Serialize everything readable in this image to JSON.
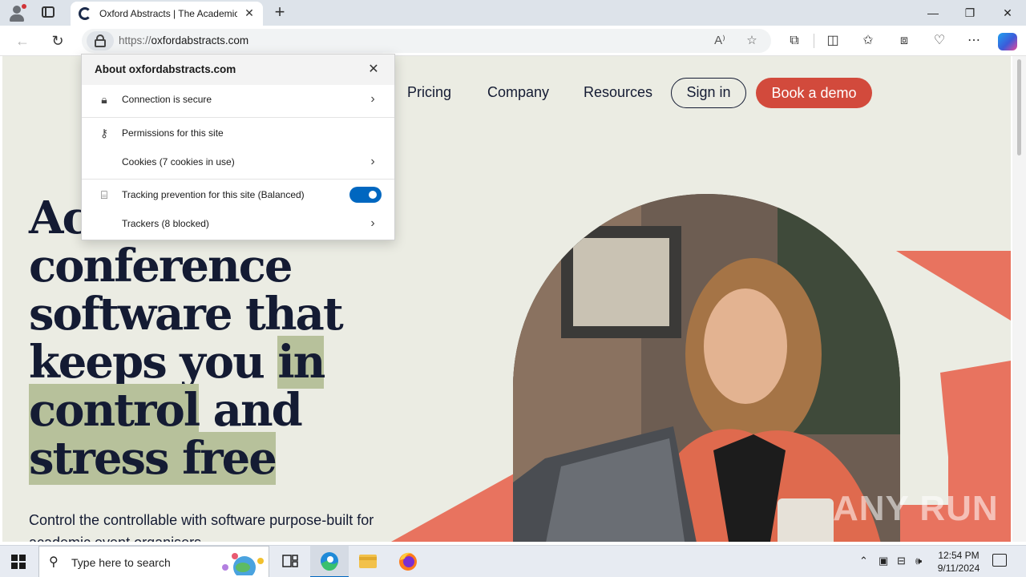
{
  "browser": {
    "tab_title": "Oxford Abstracts | The Academic",
    "url_protocol": "https://",
    "url_host": "oxfordabstracts.com"
  },
  "site_nav": {
    "links": [
      "Pricing",
      "Company",
      "Resources"
    ],
    "sign_in": "Sign in",
    "book_demo": "Book a demo"
  },
  "hero": {
    "line1": "Ac",
    "line2": "conference",
    "line3": "software that",
    "line4_a": "keeps you ",
    "line4_b": "in",
    "line5_a": "control",
    "line5_b": " and",
    "line6": "stress free",
    "subtitle": "Control the controllable with software purpose-built for academic event organisers"
  },
  "site_info_popup": {
    "title": "About oxfordabstracts.com",
    "connection": "Connection is secure",
    "permissions": "Permissions for this site",
    "cookies": "Cookies (7 cookies in use)",
    "tracking": "Tracking prevention for this site (Balanced)",
    "trackers": "Trackers (8 blocked)",
    "tracking_enabled": true
  },
  "watermark": "ANY RUN",
  "taskbar": {
    "search_placeholder": "Type here to search",
    "time": "12:54 PM",
    "date": "9/11/2024"
  },
  "colors": {
    "page_bg": "#ebece3",
    "navy": "#141b33",
    "coral": "#d24a3c",
    "highlight": "#b7c19b",
    "toggle_blue": "#0067c0"
  }
}
